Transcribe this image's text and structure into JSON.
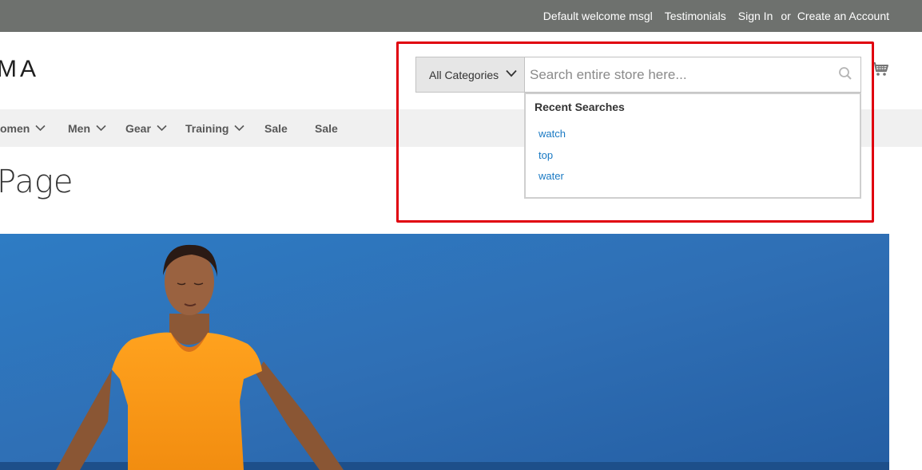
{
  "header": {
    "welcome": "Default welcome msgl",
    "links": [
      "Testimonials",
      "Sign In"
    ],
    "or_text": "or",
    "create_account": "Create an Account",
    "logo_text": "MA"
  },
  "nav": {
    "items": [
      {
        "label": "Women",
        "display": "omen",
        "has_dropdown": true
      },
      {
        "label": "Men",
        "has_dropdown": true
      },
      {
        "label": "Gear",
        "has_dropdown": true
      },
      {
        "label": "Training",
        "has_dropdown": true
      },
      {
        "label": "Sale",
        "has_dropdown": false
      },
      {
        "label": "Sale",
        "has_dropdown": false
      }
    ]
  },
  "page": {
    "title": "Page"
  },
  "search": {
    "category_selected": "All Categories",
    "placeholder": "Search entire store here...",
    "value": "",
    "recent_header": "Recent Searches",
    "recent": [
      "watch",
      "top",
      "water"
    ]
  },
  "icons": {
    "search": "search-icon",
    "cart": "cart-icon",
    "chevron": "chevron-down-icon"
  },
  "colors": {
    "topbar": "#6e716e",
    "nav_bg": "#f0f0f0",
    "link": "#1979c3",
    "highlight": "#e0000e"
  }
}
